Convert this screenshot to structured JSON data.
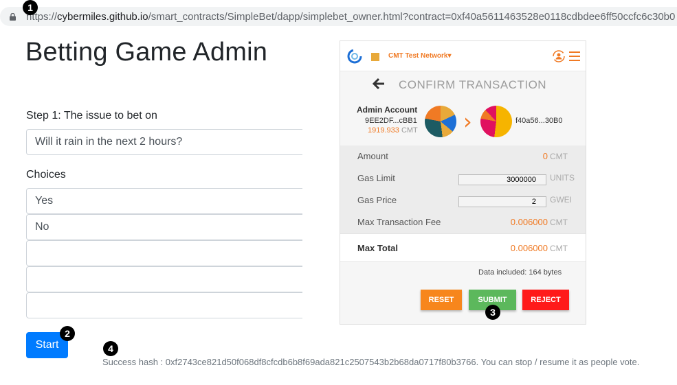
{
  "browser": {
    "url_host_prefix": "https://",
    "url_host": "cybermiles.github.io",
    "url_path": "/smart_contracts/SimpleBet/dapp/simplebet_owner.html?contract=0xf40a5611463528e0118cdbdee6ff50ccfc6c30b0"
  },
  "annotations": {
    "b1": "1",
    "b2": "2",
    "b3": "3",
    "b4": "4"
  },
  "form": {
    "title": "Betting Game Admin",
    "step1_label": "Step 1: The issue to bet on",
    "issue_value": "Will it rain in the next 2 hours?",
    "choices_label": "Choices",
    "choices": [
      "Yes",
      "No",
      "",
      "",
      ""
    ],
    "start_label": "Start",
    "success_text": "Success hash : 0xf2743ce821d50f068df8cfcdb6b8f69ada821c2507543b2b68da0717f80b3766. You can stop / resume it as people vote."
  },
  "wallet": {
    "network": "CMT Test Network",
    "network_caret": "▾",
    "header_title": "CONFIRM TRANSACTION",
    "from_name": "Admin Account",
    "from_address": "9EE2DF...cBB1",
    "from_balance": "1919.933",
    "balance_unit": "CMT",
    "to_address": "f40a56...30B0",
    "rows": {
      "amount_label": "Amount",
      "amount_value": "0",
      "amount_unit": "CMT",
      "gas_limit_label": "Gas Limit",
      "gas_limit_value": "3000000",
      "gas_limit_unit": "UNITS",
      "gas_price_label": "Gas Price",
      "gas_price_value": "2",
      "gas_price_unit": "GWEI",
      "max_fee_label": "Max Transaction Fee",
      "max_fee_value": "0.006000",
      "max_fee_unit": "CMT"
    },
    "total_label": "Max Total",
    "total_value": "0.006000",
    "total_unit": "CMT",
    "data_included": "Data included: 164 bytes",
    "buttons": {
      "reset": "RESET",
      "submit": "SUBMIT",
      "reject": "REJECT"
    }
  },
  "colors": {
    "accent_orange": "#f07a24",
    "primary_blue": "#007bff",
    "submit_green": "#5cb85c",
    "reject_red": "#ff1a1a"
  }
}
